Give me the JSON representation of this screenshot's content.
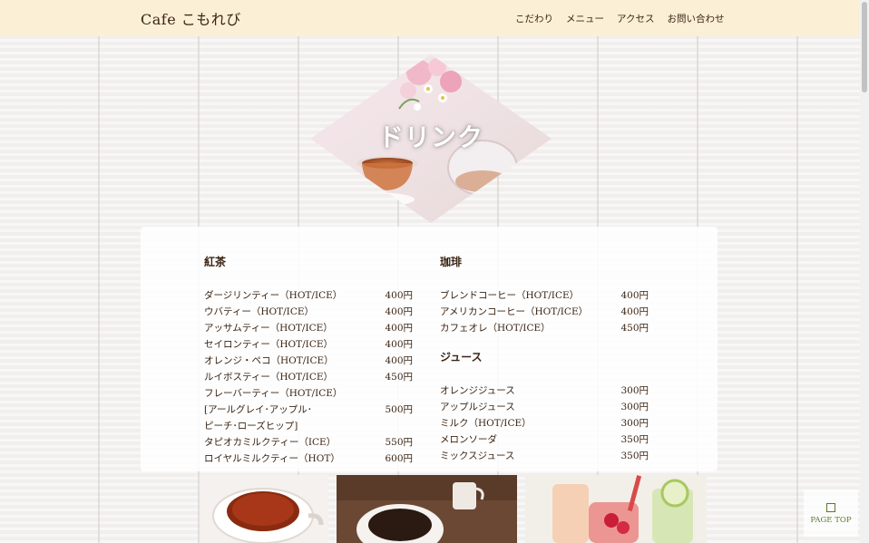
{
  "header": {
    "logo": "Cafe こもれび",
    "nav": [
      "こだわり",
      "メニュー",
      "アクセス",
      "お問い合わせ"
    ]
  },
  "hero": {
    "title": "ドリンク"
  },
  "menu": {
    "tea": {
      "heading": "紅茶",
      "items": [
        {
          "name": "ダージリンティー（HOT/ICE）",
          "price": "400円"
        },
        {
          "name": "ウバティー（HOT/ICE）",
          "price": "400円"
        },
        {
          "name": "アッサムティー（HOT/ICE）",
          "price": "400円"
        },
        {
          "name": "セイロンティー（HOT/ICE）",
          "price": "400円"
        },
        {
          "name": "オレンジ・ペコ（HOT/ICE）",
          "price": "400円"
        },
        {
          "name": "ルイボスティー（HOT/ICE）",
          "price": "450円"
        },
        {
          "name": "フレーバーティー（HOT/ICE）\n[アールグレイ･アップル･\nピーチ･ローズヒップ]",
          "price": "500円"
        },
        {
          "name": "タピオカミルクティー（ICE）",
          "price": "550円"
        },
        {
          "name": "ロイヤルミルクティー（HOT）",
          "price": "600円"
        }
      ]
    },
    "coffee": {
      "heading": "珈琲",
      "items": [
        {
          "name": "ブレンドコーヒー（HOT/ICE）",
          "price": "400円"
        },
        {
          "name": "アメリカンコーヒー（HOT/ICE）",
          "price": "400円"
        },
        {
          "name": "カフェオレ（HOT/ICE）",
          "price": "450円"
        }
      ]
    },
    "juice": {
      "heading": "ジュース",
      "items": [
        {
          "name": "オレンジジュース",
          "price": "300円"
        },
        {
          "name": "アップルジュース",
          "price": "300円"
        },
        {
          "name": "ミルク（HOT/ICE）",
          "price": "300円"
        },
        {
          "name": "メロンソーダ",
          "price": "350円"
        },
        {
          "name": "ミックスジュース",
          "price": "350円"
        }
      ]
    }
  },
  "pagetop": {
    "label": "PAGE TOP"
  },
  "colors": {
    "header_bg": "#fbefd6",
    "text": "#3b2413",
    "accent": "#5a7a2a"
  }
}
